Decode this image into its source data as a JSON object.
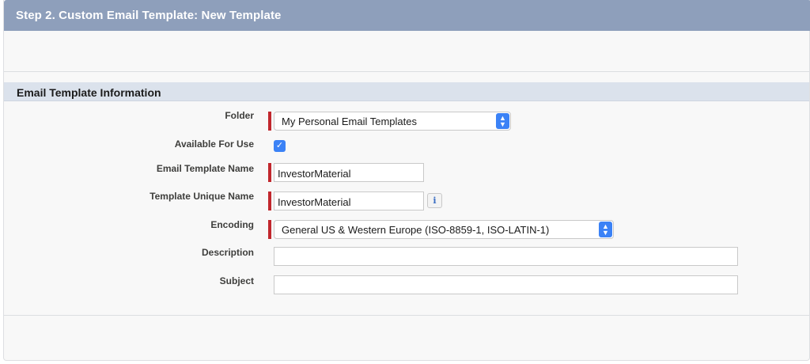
{
  "header": {
    "title": "Step 2. Custom Email Template: New Template"
  },
  "section": {
    "title": "Email Template Information"
  },
  "fields": {
    "folder": {
      "label": "Folder",
      "value": "My Personal Email Templates"
    },
    "available": {
      "label": "Available For Use",
      "checked": true
    },
    "template_name": {
      "label": "Email Template Name",
      "value": "InvestorMaterial"
    },
    "unique_name": {
      "label": "Template Unique Name",
      "value": "InvestorMaterial"
    },
    "encoding": {
      "label": "Encoding",
      "value": "General US & Western Europe (ISO-8859-1, ISO-LATIN-1)"
    },
    "description": {
      "label": "Description",
      "value": ""
    },
    "subject": {
      "label": "Subject",
      "value": ""
    }
  },
  "colors": {
    "header": "#8e9fbb",
    "required": "#c1272d",
    "accent": "#3b82f6"
  },
  "icons": {
    "select_arrow": "chevron-up-down-icon",
    "checkmark": "checkmark-icon",
    "info": "info-icon"
  }
}
